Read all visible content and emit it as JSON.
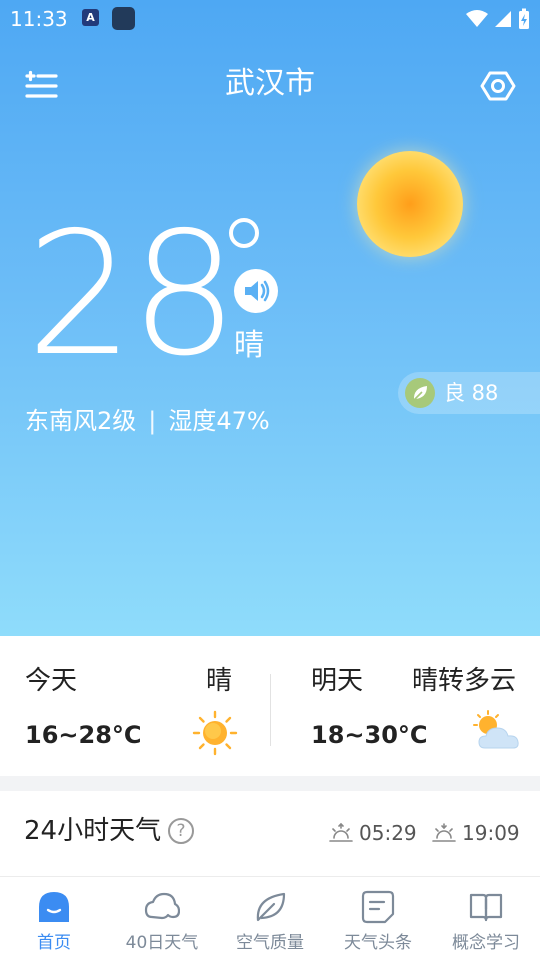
{
  "status_bar": {
    "time": "11:33",
    "app_icon_letter": "A"
  },
  "header": {
    "city": "武汉市"
  },
  "current": {
    "temperature": "28",
    "condition": "晴",
    "wind": "东南风2级",
    "separator": "|",
    "humidity": "湿度47%",
    "aqi_text": "良 88"
  },
  "forecast": {
    "today": {
      "label": "今天",
      "condition": "晴",
      "range": "16~28°C",
      "icon": "sunny-icon"
    },
    "tomorrow": {
      "label": "明天",
      "condition": "晴转多云",
      "range": "18~30°C",
      "icon": "partly-cloudy-icon"
    }
  },
  "hourly": {
    "title": "24小时天气",
    "help": "?",
    "sunrise": "05:29",
    "sunset": "19:09"
  },
  "nav": {
    "items": [
      {
        "label": "首页",
        "icon": "home-icon",
        "active": true
      },
      {
        "label": "40日天气",
        "icon": "cloud-icon",
        "active": false
      },
      {
        "label": "空气质量",
        "icon": "leaf-icon",
        "active": false
      },
      {
        "label": "天气头条",
        "icon": "news-icon",
        "active": false
      },
      {
        "label": "概念学习",
        "icon": "book-icon",
        "active": false
      }
    ]
  },
  "colors": {
    "sky_top": "#4ea8f3",
    "sky_bottom": "#8fdcfb",
    "accent": "#3b8cf2",
    "sun": "#ffb22e"
  }
}
